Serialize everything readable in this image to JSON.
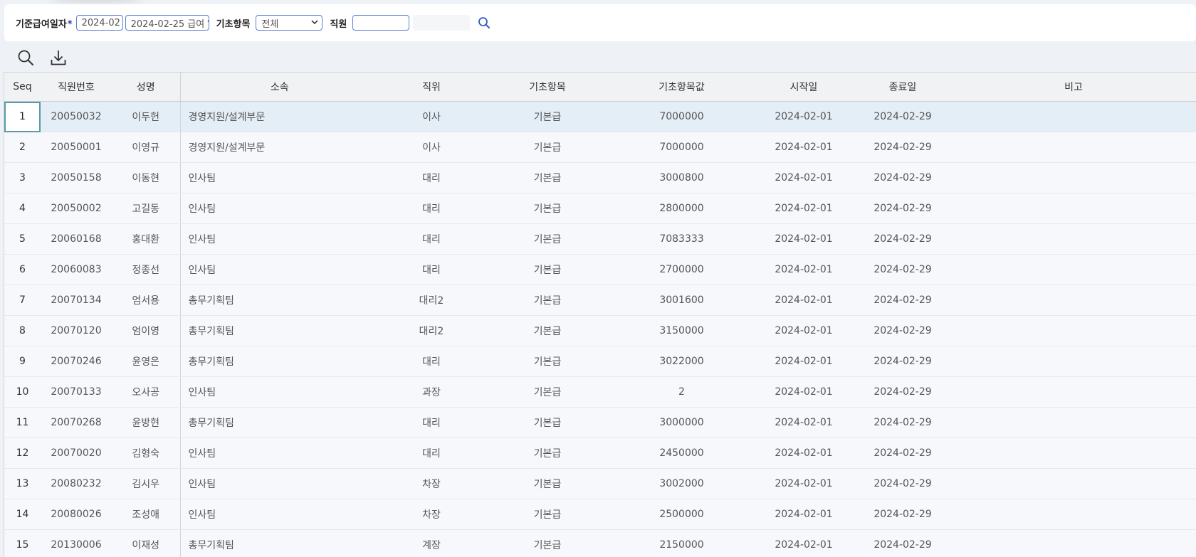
{
  "filter": {
    "base_date_label": "기준급여일자",
    "required_mark": "*",
    "month_value": "2024-02",
    "pay_value": "2024-02-25 급여",
    "item_label": "기초항목",
    "item_value": "전체",
    "employee_label": "직원",
    "employee_value": "",
    "employee_name_value": ""
  },
  "toolbar": {
    "search_icon": "search-icon",
    "download_icon": "download-icon"
  },
  "columns": {
    "seq": "Seq",
    "emp_no": "직원번호",
    "name": "성명",
    "dept": "소속",
    "position": "직위",
    "item": "기초항목",
    "item_value": "기초항목값",
    "start": "시작일",
    "end": "종료일",
    "note": "비고"
  },
  "rows": [
    {
      "seq": "1",
      "emp_no": "20050032",
      "name": "이두헌",
      "dept": "경영지원/설계부문",
      "position": "이사",
      "item": "기본급",
      "value": "7000000",
      "start": "2024-02-01",
      "end": "2024-02-29",
      "note": ""
    },
    {
      "seq": "2",
      "emp_no": "20050001",
      "name": "이영규",
      "dept": "경영지원/설계부문",
      "position": "이사",
      "item": "기본급",
      "value": "7000000",
      "start": "2024-02-01",
      "end": "2024-02-29",
      "note": ""
    },
    {
      "seq": "3",
      "emp_no": "20050158",
      "name": "이동현",
      "dept": "인사팀",
      "position": "대리",
      "item": "기본급",
      "value": "3000800",
      "start": "2024-02-01",
      "end": "2024-02-29",
      "note": ""
    },
    {
      "seq": "4",
      "emp_no": "20050002",
      "name": "고길동",
      "dept": "인사팀",
      "position": "대리",
      "item": "기본급",
      "value": "2800000",
      "start": "2024-02-01",
      "end": "2024-02-29",
      "note": ""
    },
    {
      "seq": "5",
      "emp_no": "20060168",
      "name": "홍대환",
      "dept": "인사팀",
      "position": "대리",
      "item": "기본급",
      "value": "7083333",
      "start": "2024-02-01",
      "end": "2024-02-29",
      "note": ""
    },
    {
      "seq": "6",
      "emp_no": "20060083",
      "name": "정종선",
      "dept": "인사팀",
      "position": "대리",
      "item": "기본급",
      "value": "2700000",
      "start": "2024-02-01",
      "end": "2024-02-29",
      "note": ""
    },
    {
      "seq": "7",
      "emp_no": "20070134",
      "name": "엄서용",
      "dept": "총무기획팀",
      "position": "대리2",
      "item": "기본급",
      "value": "3001600",
      "start": "2024-02-01",
      "end": "2024-02-29",
      "note": ""
    },
    {
      "seq": "8",
      "emp_no": "20070120",
      "name": "엄이영",
      "dept": "총무기획팀",
      "position": "대리2",
      "item": "기본급",
      "value": "3150000",
      "start": "2024-02-01",
      "end": "2024-02-29",
      "note": ""
    },
    {
      "seq": "9",
      "emp_no": "20070246",
      "name": "윤영은",
      "dept": "총무기획팀",
      "position": "대리",
      "item": "기본급",
      "value": "3022000",
      "start": "2024-02-01",
      "end": "2024-02-29",
      "note": ""
    },
    {
      "seq": "10",
      "emp_no": "20070133",
      "name": "오사공",
      "dept": "인사팀",
      "position": "과장",
      "item": "기본급",
      "value": "2",
      "start": "2024-02-01",
      "end": "2024-02-29",
      "note": ""
    },
    {
      "seq": "11",
      "emp_no": "20070268",
      "name": "윤방현",
      "dept": "총무기획팀",
      "position": "대리",
      "item": "기본급",
      "value": "3000000",
      "start": "2024-02-01",
      "end": "2024-02-29",
      "note": ""
    },
    {
      "seq": "12",
      "emp_no": "20070020",
      "name": "김형숙",
      "dept": "인사팀",
      "position": "대리",
      "item": "기본급",
      "value": "2450000",
      "start": "2024-02-01",
      "end": "2024-02-29",
      "note": ""
    },
    {
      "seq": "13",
      "emp_no": "20080232",
      "name": "김시우",
      "dept": "인사팀",
      "position": "차장",
      "item": "기본급",
      "value": "3002000",
      "start": "2024-02-01",
      "end": "2024-02-29",
      "note": ""
    },
    {
      "seq": "14",
      "emp_no": "20080026",
      "name": "조성애",
      "dept": "인사팀",
      "position": "차장",
      "item": "기본급",
      "value": "2500000",
      "start": "2024-02-01",
      "end": "2024-02-29",
      "note": ""
    },
    {
      "seq": "15",
      "emp_no": "20130006",
      "name": "이재성",
      "dept": "총무기획팀",
      "position": "계장",
      "item": "기본급",
      "value": "2150000",
      "start": "2024-02-01",
      "end": "2024-02-29",
      "note": ""
    }
  ]
}
